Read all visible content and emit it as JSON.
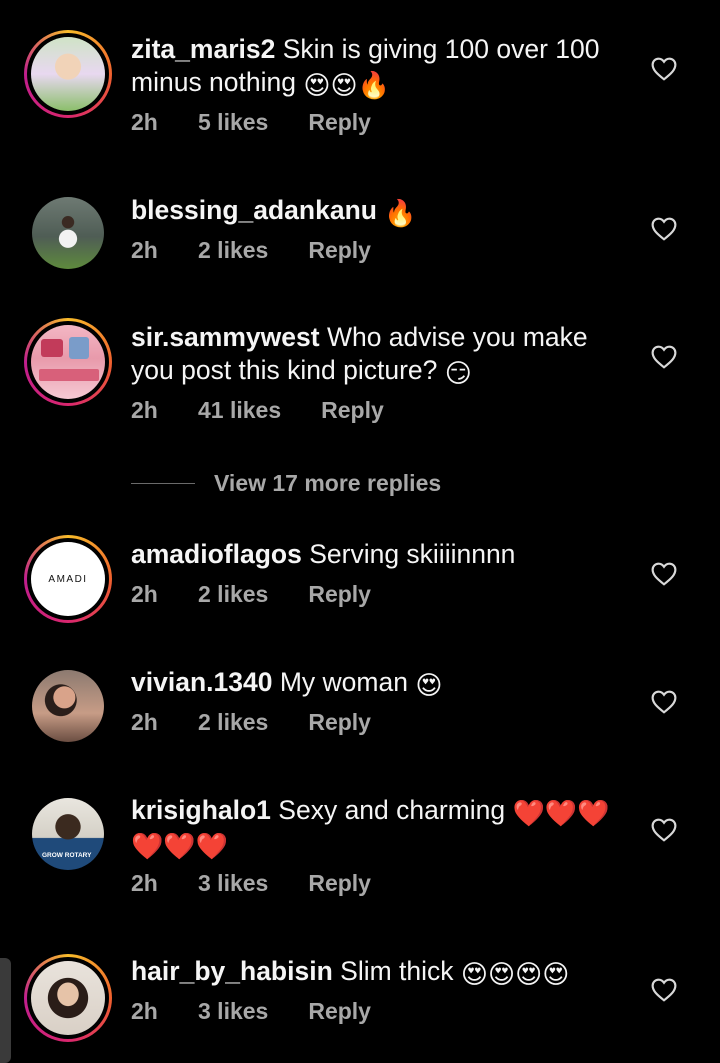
{
  "comments": [
    {
      "username": "zita_maris2",
      "text": "Skin is giving 100 over 100 minus nothing",
      "emojis": "😍😍🔥",
      "time": "2h",
      "likes": "5 likes",
      "reply": "Reply",
      "avatar": "zita-avatar"
    },
    {
      "username": "blessing_adankanu",
      "text": "",
      "emojis": "🔥",
      "time": "2h",
      "likes": "2 likes",
      "reply": "Reply",
      "avatar": "blessing-avatar"
    },
    {
      "username": "sir.sammywest",
      "text": "Who advise you make you post this kind picture?",
      "emojis": "😏",
      "time": "2h",
      "likes": "41 likes",
      "reply": "Reply",
      "avatar": "sammywest-avatar"
    },
    {
      "username": "amadioflagos",
      "text": "Serving skiiiinnnn",
      "emojis": "",
      "time": "2h",
      "likes": "2 likes",
      "reply": "Reply",
      "avatar": "amadi-logo",
      "avatar_text": "AMADI"
    },
    {
      "username": "vivian.1340",
      "text": "My woman",
      "emojis": "😍",
      "time": "2h",
      "likes": "2 likes",
      "reply": "Reply",
      "avatar": "vivian-avatar"
    },
    {
      "username": "krisighalo1",
      "text": "Sexy and charming",
      "emojis": "❤️❤️❤️❤️❤️❤️",
      "time": "2h",
      "likes": "3 likes",
      "reply": "Reply",
      "avatar": "krisighalo-avatar",
      "avatar_text": "GROW ROTARY"
    },
    {
      "username": "hair_by_habisin",
      "text": "Slim thick",
      "emojis": "😍😍😍😍",
      "time": "2h",
      "likes": "3 likes",
      "reply": "Reply",
      "avatar": "habisin-avatar"
    }
  ],
  "view_more": "View 17 more replies",
  "icons": {
    "like": "heart-outline-icon"
  },
  "colors": {
    "background": "#000000",
    "text": "#f5f5f5",
    "meta": "#a8a8a8",
    "story_ring": [
      "#f8bc2a",
      "#f0612e",
      "#d9266e",
      "#c01e8e"
    ],
    "heart_emoji": "#e0182d"
  }
}
